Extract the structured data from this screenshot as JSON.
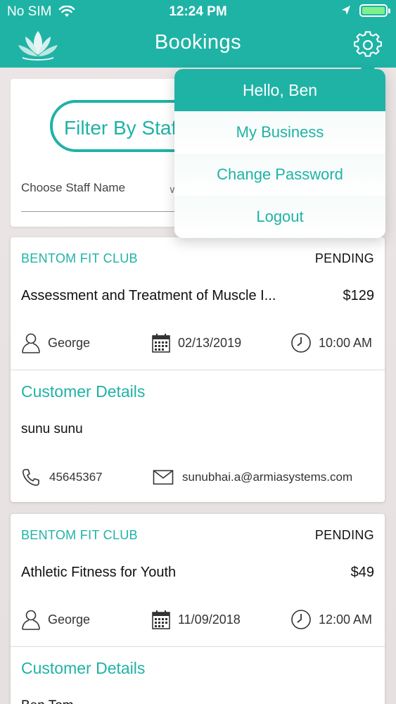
{
  "status_bar": {
    "carrier": "No SIM",
    "time": "12:24 PM"
  },
  "header": {
    "title": "Bookings"
  },
  "filter": {
    "pill_label": "Filter By Staff",
    "staff_placeholder": "Choose Staff Name"
  },
  "menu": {
    "greeting": "Hello, Ben",
    "items": [
      "My Business",
      "Change Password",
      "Logout"
    ]
  },
  "bookings": [
    {
      "club": "BENTOM FIT CLUB",
      "status": "PENDING",
      "service": "Assessment and Treatment of Muscle I...",
      "price": "$129",
      "staff": "George",
      "date": "02/13/2019",
      "time": "10:00 AM",
      "customer_title": "Customer Details",
      "customer_name": "sunu sunu",
      "phone": "45645367",
      "email": "sunubhai.a@armiasystems.com"
    },
    {
      "club": "BENTOM FIT CLUB",
      "status": "PENDING",
      "service": "Athletic Fitness for Youth",
      "price": "$49",
      "staff": "George",
      "date": "11/09/2018",
      "time": "12:00 AM",
      "customer_title": "Customer Details",
      "customer_name": "Ben Tom"
    }
  ],
  "colors": {
    "accent": "#1fb3a6",
    "battery": "#7ef08c"
  },
  "icons": [
    "wifi-icon",
    "location-arrow-icon",
    "battery-icon",
    "lotus-logo-icon",
    "gear-icon",
    "user-icon",
    "calendar-icon",
    "clock-icon",
    "phone-icon",
    "mail-icon",
    "chevron-down-icon"
  ]
}
